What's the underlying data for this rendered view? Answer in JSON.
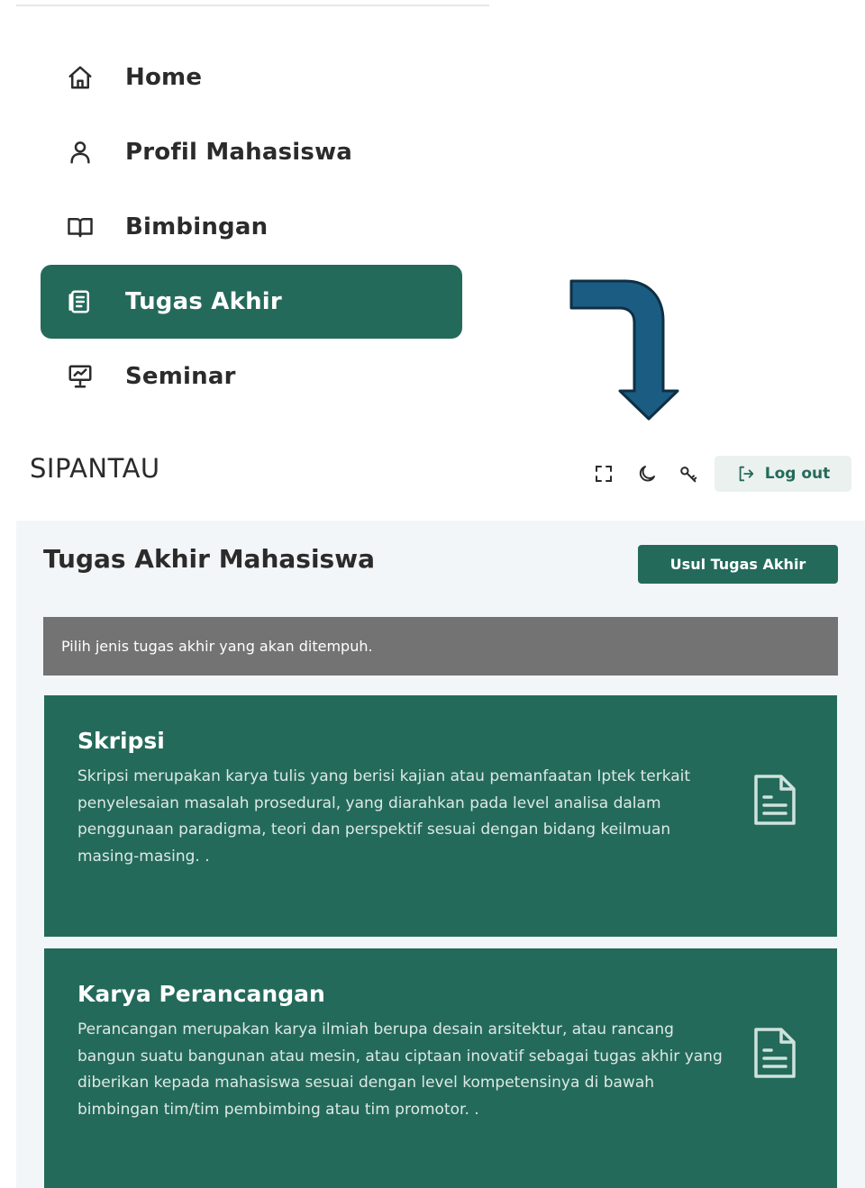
{
  "sidebar": {
    "items": [
      {
        "label": "Home",
        "icon": "home-icon",
        "active": false
      },
      {
        "label": "Profil Mahasiswa",
        "icon": "user-icon",
        "active": false
      },
      {
        "label": "Bimbingan",
        "icon": "book-icon",
        "active": false
      },
      {
        "label": "Tugas Akhir",
        "icon": "document-icon",
        "active": true
      },
      {
        "label": "Seminar",
        "icon": "presentation-icon",
        "active": false
      }
    ]
  },
  "header": {
    "brand": "SIPANTAU",
    "icons": [
      "fullscreen-icon",
      "moon-icon",
      "key-icon"
    ],
    "logout_label": "Log out"
  },
  "main": {
    "title": "Tugas Akhir Mahasiswa",
    "primary_button": "Usul Tugas Akhir",
    "info": "Pilih jenis tugas akhir yang akan ditempuh.",
    "cards": [
      {
        "title": "Skripsi",
        "description": "Skripsi merupakan karya tulis yang berisi kajian atau pemanfaatan Iptek terkait penyelesaian masalah prosedural, yang diarahkan pada level analisa dalam penggunaan paradigma, teori dan perspektif sesuai dengan bidang keilmuan masing-masing. .",
        "icon": "file-text-icon"
      },
      {
        "title": "Karya Perancangan",
        "description": "Perancangan merupakan karya ilmiah berupa desain arsitektur, atau rancang bangun suatu bangunan atau mesin, atau ciptaan inovatif sebagai tugas akhir yang diberikan kepada mahasiswa sesuai dengan level kompetensinya di bawah bimbingan tim/tim pembimbing atau tim promotor. .",
        "icon": "file-text-icon"
      }
    ]
  },
  "colors": {
    "primary": "#246a5b",
    "info_bar": "#737373",
    "arrow": "#1b5c82",
    "content_bg": "#f3f6f9"
  }
}
